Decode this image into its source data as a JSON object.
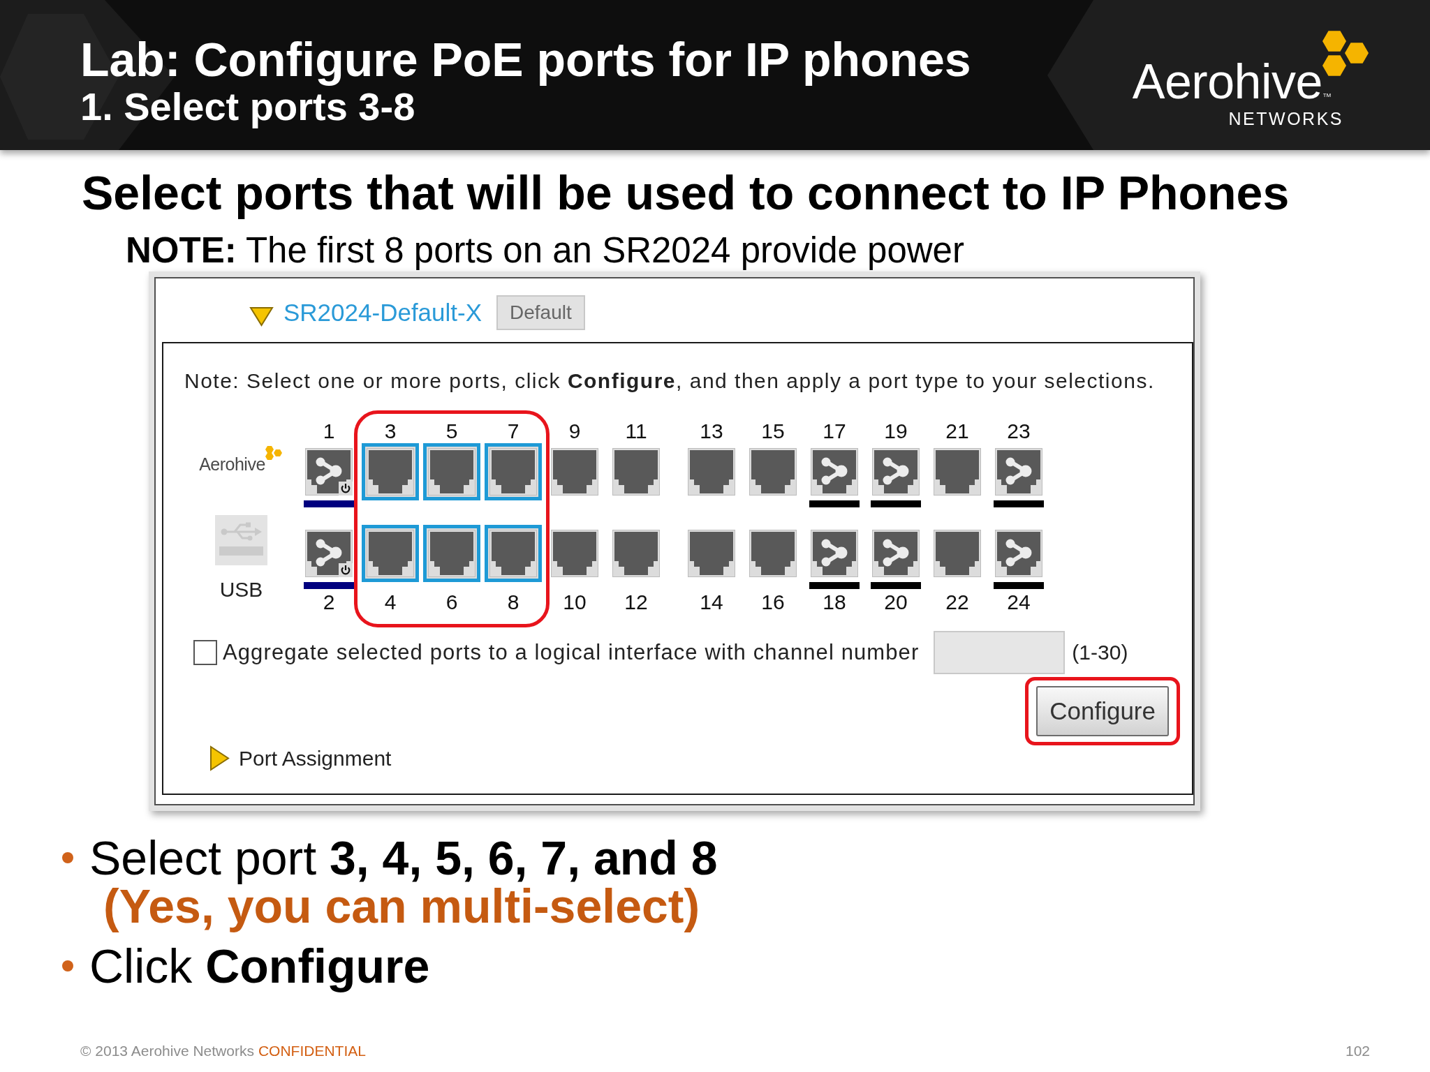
{
  "header": {
    "title": "Lab: Configure PoE ports for IP phones",
    "subtitle": "1. Select ports 3-8",
    "logo": {
      "name": "Aerohive",
      "tm": "™",
      "tagline": "NETWORKS"
    }
  },
  "heading": "Select ports that will be used to connect to IP Phones",
  "note": "**NOTE:** The first 8 ports on an SR2024 provide power",
  "screenshot": {
    "device": {
      "name": "SR2024-Default-X",
      "expanded": true,
      "badge": "Default"
    },
    "instructions": "Note: Select one or more ports, click **Configure**, and then apply a port type to your selections.",
    "switch_logo": "Aerohive",
    "usb_label": "USB",
    "port_banks": [
      {
        "ports": [
          {
            "label": "1",
            "selected": false,
            "kind": "branch",
            "power": true,
            "color": "#00007f"
          },
          {
            "label": "2",
            "selected": false,
            "kind": "branch",
            "power": true,
            "color": "#00007f"
          },
          {
            "label": "3",
            "selected": true,
            "kind": "plain",
            "power": false
          },
          {
            "label": "4",
            "selected": true,
            "kind": "plain",
            "power": false
          },
          {
            "label": "5",
            "selected": true,
            "kind": "plain",
            "power": false
          },
          {
            "label": "6",
            "selected": true,
            "kind": "plain",
            "power": false
          },
          {
            "label": "7",
            "selected": true,
            "kind": "plain",
            "power": false
          },
          {
            "label": "8",
            "selected": true,
            "kind": "plain",
            "power": false
          },
          {
            "label": "9",
            "selected": false,
            "kind": "plain",
            "power": false
          },
          {
            "label": "10",
            "selected": false,
            "kind": "plain",
            "power": false
          },
          {
            "label": "11",
            "selected": false,
            "kind": "plain",
            "power": false
          },
          {
            "label": "12",
            "selected": false,
            "kind": "plain",
            "power": false
          }
        ]
      },
      {
        "ports": [
          {
            "label": "13",
            "selected": false,
            "kind": "plain",
            "power": false
          },
          {
            "label": "14",
            "selected": false,
            "kind": "plain",
            "power": false
          },
          {
            "label": "15",
            "selected": false,
            "kind": "plain",
            "power": false
          },
          {
            "label": "16",
            "selected": false,
            "kind": "plain",
            "power": false
          },
          {
            "label": "17",
            "selected": false,
            "kind": "branch",
            "power": false,
            "color": "#000000"
          },
          {
            "label": "18",
            "selected": false,
            "kind": "branch",
            "power": false,
            "color": "#000000"
          },
          {
            "label": "19",
            "selected": false,
            "kind": "branch",
            "power": false,
            "color": "#000000"
          },
          {
            "label": "20",
            "selected": false,
            "kind": "branch",
            "power": false,
            "color": "#000000"
          },
          {
            "label": "21",
            "selected": false,
            "kind": "plain",
            "power": false
          },
          {
            "label": "22",
            "selected": false,
            "kind": "plain",
            "power": false
          },
          {
            "label": "23",
            "selected": false,
            "kind": "branch",
            "power": false,
            "color": "#000000"
          },
          {
            "label": "24",
            "selected": false,
            "kind": "branch",
            "power": false,
            "color": "#000000"
          }
        ]
      }
    ],
    "aggregate": {
      "checked": false,
      "label": "Aggregate selected ports to a logical interface with channel number",
      "range_hint": "(1-30)"
    },
    "configure_button": {
      "label": "Configure",
      "highlighted": true
    },
    "port_assignment": {
      "label": "Port Assignment",
      "expanded": false
    }
  },
  "bullets": [
    {
      "text": "Select port **3, 4, 5, 6, 7, and 8**",
      "note": "(Yes, you can multi-select)"
    },
    {
      "text": "Click **Configure**"
    }
  ],
  "footer": {
    "copyright": "© 2013 Aerohive Networks",
    "label": "CONFIDENTIAL",
    "page": "102"
  }
}
